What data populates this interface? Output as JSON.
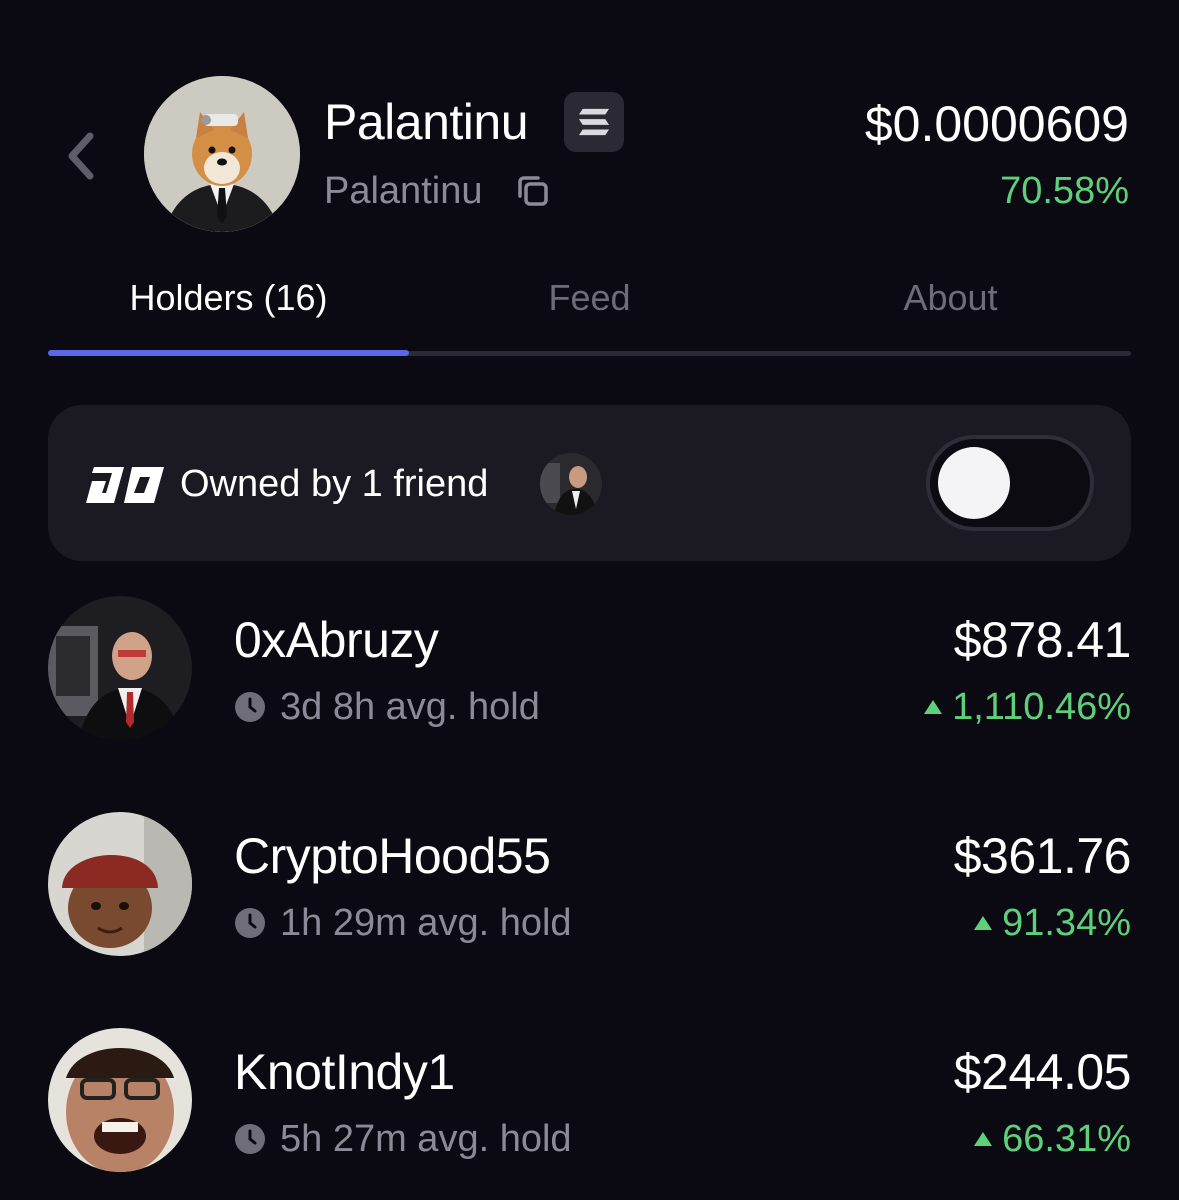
{
  "header": {
    "token_name": "Palantinu",
    "token_ticker": "Palantinu",
    "price": "$0.0000609",
    "price_change": "70.58%",
    "chain_icon": "solana-icon",
    "colors": {
      "positive": "#5fd07a",
      "accent": "#5a67e8"
    }
  },
  "tabs": [
    {
      "label": "Holders (16)",
      "active": true
    },
    {
      "label": "Feed",
      "active": false
    },
    {
      "label": "About",
      "active": false
    }
  ],
  "friends": {
    "label": "Owned by 1 friend",
    "toggle_on": false
  },
  "holders": [
    {
      "name": "0xAbruzy",
      "hold": "3d 8h avg. hold",
      "value": "$878.41",
      "change": "1,110.46%"
    },
    {
      "name": "CryptoHood55",
      "hold": "1h 29m avg. hold",
      "value": "$361.76",
      "change": "91.34%"
    },
    {
      "name": "KnotIndy1",
      "hold": "5h 27m avg. hold",
      "value": "$244.05",
      "change": "66.31%"
    }
  ]
}
